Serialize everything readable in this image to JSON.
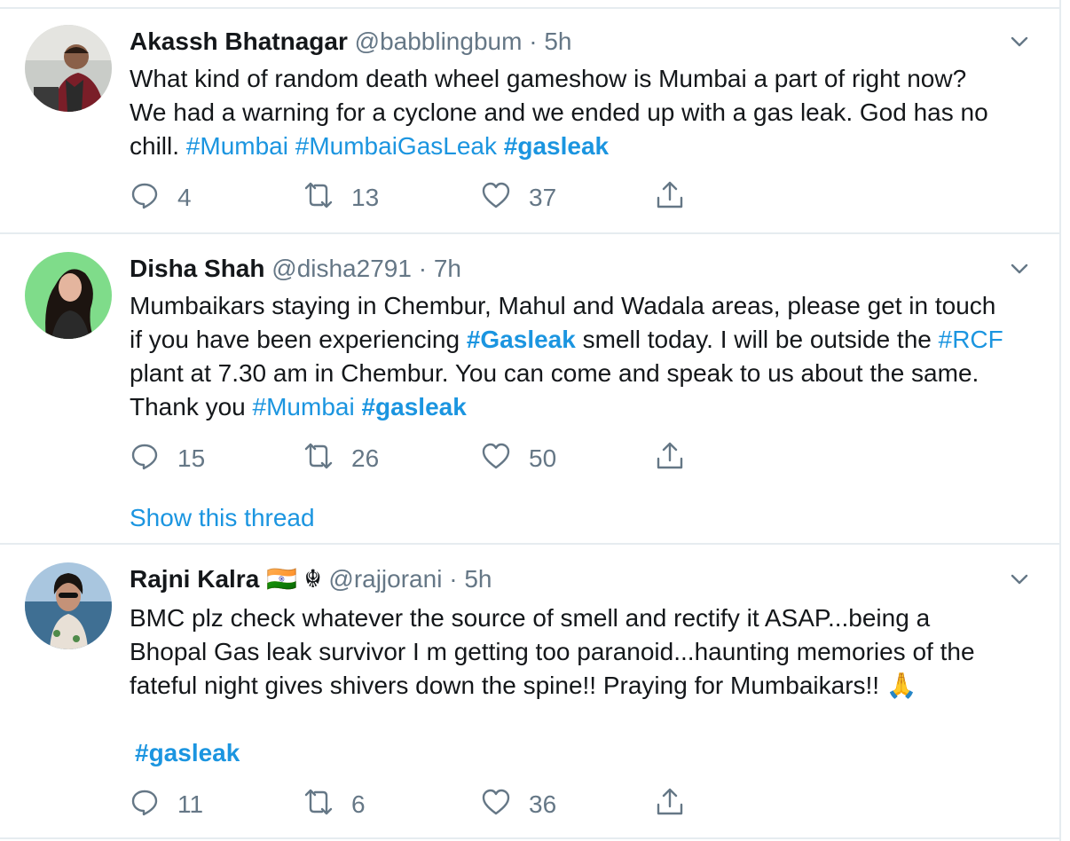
{
  "tweets": [
    {
      "name": "Akassh Bhatnagar",
      "handle": "@babblingbum",
      "separator": "·",
      "time": "5h",
      "text_segments": [
        {
          "text": "What kind of random death wheel gameshow is Mumbai a part of right now? We had a warning for a cyclone and we ended up with a gas leak. God has no chill. ",
          "type": "plain"
        },
        {
          "text": "#Mumbai",
          "type": "tag"
        },
        {
          "text": " ",
          "type": "plain"
        },
        {
          "text": "#MumbaiGasLeak",
          "type": "tag"
        },
        {
          "text": " ",
          "type": "plain"
        },
        {
          "text": "#gasleak",
          "type": "tag-bold"
        }
      ],
      "replies": "4",
      "retweets": "13",
      "likes": "37"
    },
    {
      "name": "Disha Shah",
      "handle": "@disha2791",
      "separator": "·",
      "time": "7h",
      "text_segments": [
        {
          "text": "Mumbaikars staying in Chembur, Mahul and Wadala areas, please get in touch if you have been experiencing ",
          "type": "plain"
        },
        {
          "text": "#Gasleak",
          "type": "tag-bold"
        },
        {
          "text": " smell today. I will be outside the ",
          "type": "plain"
        },
        {
          "text": "#RCF",
          "type": "tag"
        },
        {
          "text": " plant at 7.30 am in Chembur. You can come and speak to us about the same. Thank you ",
          "type": "plain"
        },
        {
          "text": "#Mumbai",
          "type": "tag"
        },
        {
          "text": " ",
          "type": "plain"
        },
        {
          "text": "#gasleak",
          "type": "tag-bold"
        }
      ],
      "replies": "15",
      "retweets": "26",
      "likes": "50",
      "show_thread": "Show this thread"
    },
    {
      "name": "Rajni Kalra",
      "name_suffix": "🇮🇳 ☬",
      "handle": "@rajjorani",
      "separator": "·",
      "time": "5h",
      "text_segments": [
        {
          "text": "BMC plz check whatever the source of smell and rectify it ASAP...being a Bhopal Gas leak survivor I m getting too paranoid...haunting memories of the fateful night gives shivers down the spine!! Praying for Mumbaikars!! ",
          "type": "plain"
        },
        {
          "text": "🙏",
          "type": "plain"
        }
      ],
      "extra_tag": "#gasleak",
      "replies": "11",
      "retweets": "6",
      "likes": "36"
    }
  ],
  "icons": {
    "reply": "reply-icon",
    "retweet": "retweet-icon",
    "like": "like-icon",
    "share": "share-icon",
    "caret": "chevron-down-icon"
  },
  "colors": {
    "link": "#1b95e0",
    "muted": "#657786",
    "text": "#14171a",
    "divider": "#e6ecf0"
  }
}
